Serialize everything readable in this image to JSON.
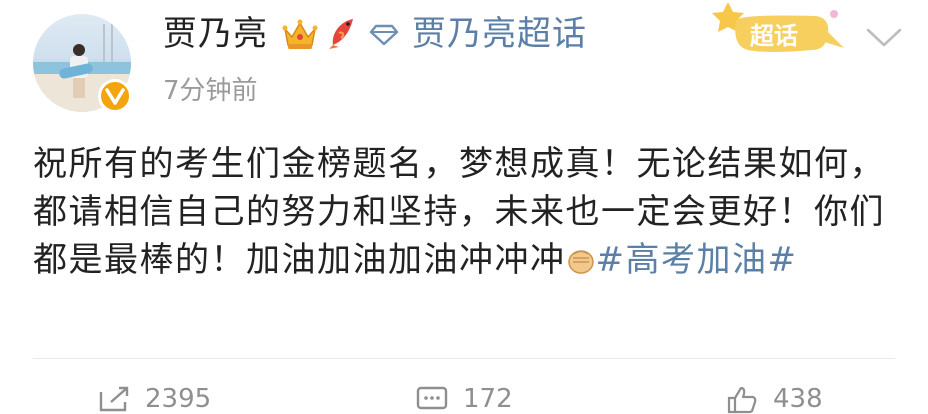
{
  "post": {
    "author": {
      "name": "贾乃亮",
      "verified": true,
      "badge_color": "#f4a40c"
    },
    "topic_link": "贾乃亮超话",
    "supertopic_badge": "超话",
    "time": "7分钟前",
    "content": {
      "text": "祝所有的考生们金榜题名，梦想成真！无论结果如何，都请相信自己的努力和坚持，未来也一定会更好！你们都是最棒的！加油加油加油冲冲冲",
      "hashtag": "#高考加油#"
    },
    "actions": {
      "repost_count": "2395",
      "comment_count": "172",
      "like_count": "438"
    }
  },
  "icons": [
    "crown-icon",
    "koi-fish-icon",
    "diamond-icon",
    "supertopic-badge-icon",
    "chevron-down-icon",
    "fist-emoji-icon",
    "repost-icon",
    "comment-icon",
    "like-icon"
  ],
  "colors": {
    "link": "#5b7fa6",
    "text": "#222222",
    "muted": "#9b9b9b"
  }
}
